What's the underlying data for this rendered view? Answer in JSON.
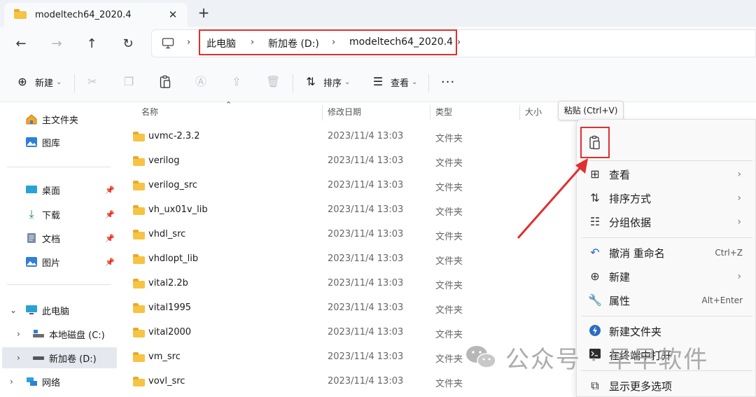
{
  "tab": {
    "title": "modeltech64_2020.4",
    "close": "✕",
    "add": "+"
  },
  "nav": {
    "back": "←",
    "forward": "→",
    "up": "↑",
    "refresh": "↻"
  },
  "breadcrumb": {
    "items": [
      "此电脑",
      "新加卷 (D:)",
      "modeltech64_2020.4"
    ],
    "sep": "›"
  },
  "toolbar": {
    "new_label": "新建",
    "sort_label": "排序",
    "view_label": "查看",
    "more_label": "···"
  },
  "sidebar": {
    "items": [
      {
        "label": "主文件夹",
        "icon": "home-icon"
      },
      {
        "label": "图库",
        "icon": "gallery-icon"
      },
      {
        "label": "桌面",
        "icon": "desktop-icon"
      },
      {
        "label": "下载",
        "icon": "download-icon"
      },
      {
        "label": "文档",
        "icon": "document-icon"
      },
      {
        "label": "图片",
        "icon": "pictures-icon"
      },
      {
        "label": "此电脑",
        "icon": "computer-icon"
      },
      {
        "label": "本地磁盘 (C:)",
        "icon": "drive-icon"
      },
      {
        "label": "新加卷 (D:)",
        "icon": "drive-icon"
      },
      {
        "label": "网络",
        "icon": "network-icon"
      }
    ]
  },
  "columns": {
    "name": "名称",
    "date": "修改日期",
    "type": "类型",
    "size": "大小"
  },
  "files": [
    {
      "name": "uvmc-2.3.2",
      "date": "2023/11/4 13:03",
      "type": "文件夹"
    },
    {
      "name": "verilog",
      "date": "2023/11/4 13:03",
      "type": "文件夹"
    },
    {
      "name": "verilog_src",
      "date": "2023/11/4 13:03",
      "type": "文件夹"
    },
    {
      "name": "vh_ux01v_lib",
      "date": "2023/11/4 13:03",
      "type": "文件夹"
    },
    {
      "name": "vhdl_src",
      "date": "2023/11/4 13:03",
      "type": "文件夹"
    },
    {
      "name": "vhdlopt_lib",
      "date": "2023/11/4 13:03",
      "type": "文件夹"
    },
    {
      "name": "vital2.2b",
      "date": "2023/11/4 13:03",
      "type": "文件夹"
    },
    {
      "name": "vital1995",
      "date": "2023/11/4 13:03",
      "type": "文件夹"
    },
    {
      "name": "vital2000",
      "date": "2023/11/4 13:03",
      "type": "文件夹"
    },
    {
      "name": "vm_src",
      "date": "2023/11/4 13:03",
      "type": "文件夹"
    },
    {
      "name": "vovl_src",
      "date": "2023/11/4 13:03",
      "type": "文件夹"
    }
  ],
  "context_menu": {
    "tooltip": "粘贴 (Ctrl+V)",
    "items": [
      {
        "label": "查看",
        "arrow": "›"
      },
      {
        "label": "排序方式",
        "arrow": "›"
      },
      {
        "label": "分组依据",
        "arrow": "›"
      },
      {
        "label": "撤消 重命名",
        "shortcut": "Ctrl+Z"
      },
      {
        "label": "新建",
        "arrow": "›"
      },
      {
        "label": "属性",
        "shortcut": "Alt+Enter"
      },
      {
        "label": "新建文件夹"
      },
      {
        "label": "在终端中打开"
      },
      {
        "label": "显示更多选项"
      }
    ]
  },
  "watermark": {
    "text": "公众号 · 早早软件"
  },
  "colors": {
    "accent": "#0067c0",
    "highlight": "#e02f2f",
    "folder": "#f7c343"
  }
}
